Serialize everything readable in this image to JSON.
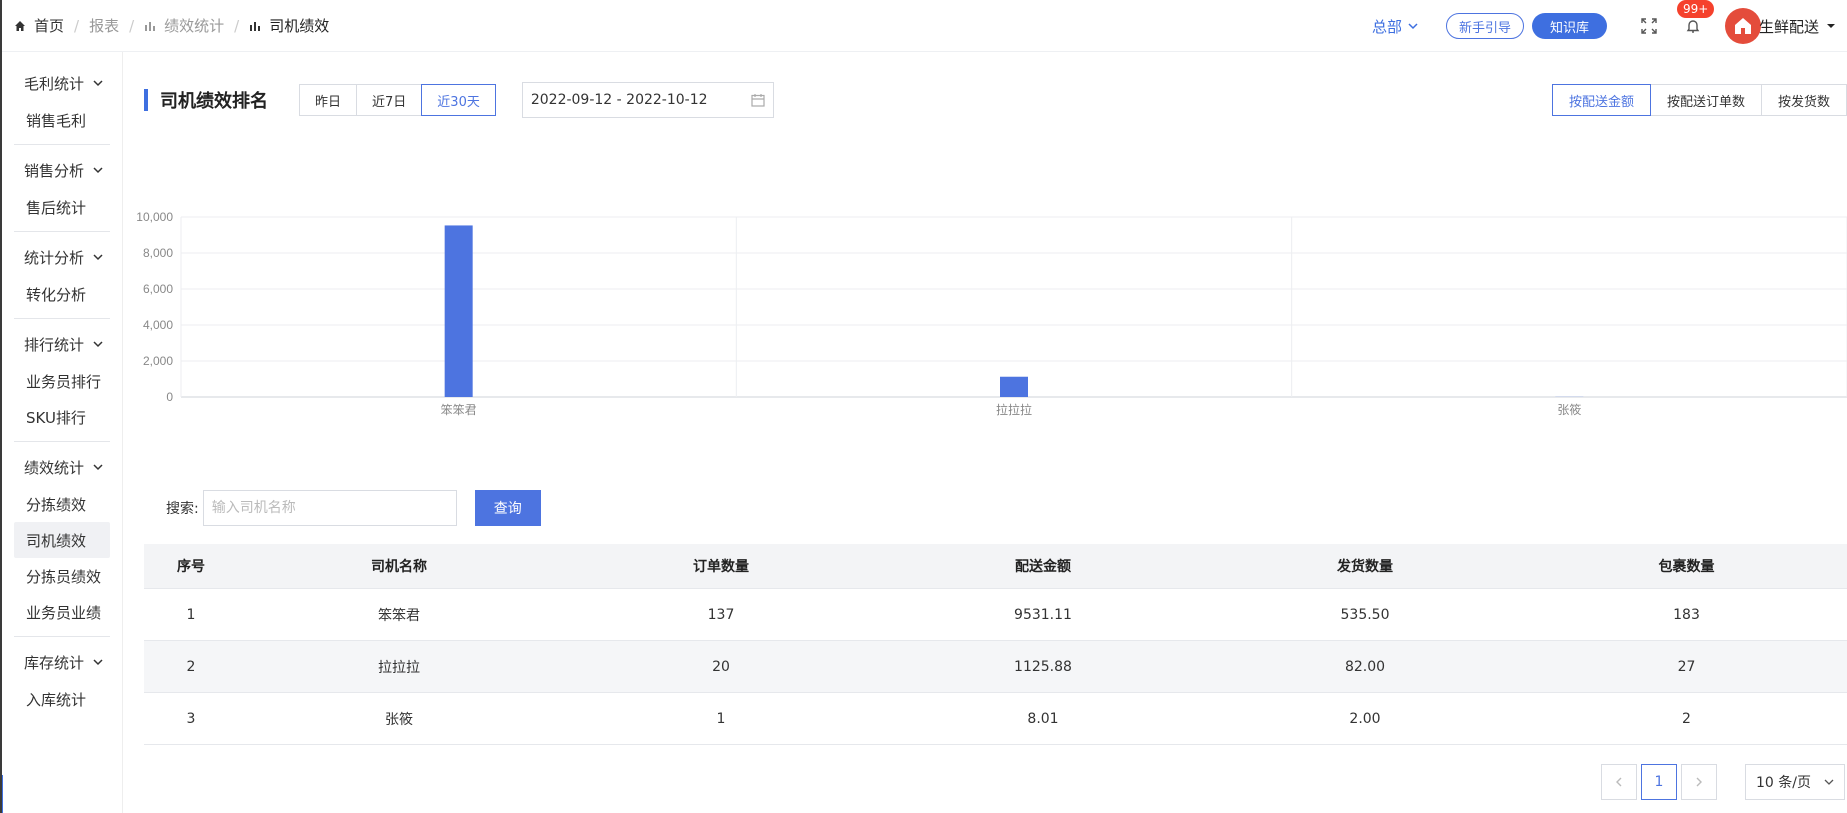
{
  "breadcrumb": {
    "home": "首页",
    "report": "报表",
    "stats": "绩效统计",
    "current": "司机绩效"
  },
  "header": {
    "org": "总部",
    "guide_btn": "新手引导",
    "kb_btn": "知识库",
    "badge": "99+",
    "user": "生鲜配送"
  },
  "sidebar": {
    "groups": [
      {
        "title": "毛利统计",
        "items": [
          "销售毛利"
        ]
      },
      {
        "title": "销售分析",
        "items": [
          "售后统计"
        ]
      },
      {
        "title": "统计分析",
        "items": [
          "转化分析"
        ]
      },
      {
        "title": "排行统计",
        "items": [
          "业务员排行",
          "SKU排行"
        ]
      },
      {
        "title": "绩效统计",
        "items": [
          "分拣绩效",
          "司机绩效",
          "分拣员绩效",
          "业务员业绩"
        ]
      },
      {
        "title": "库存统计",
        "items": [
          "入库统计"
        ]
      }
    ]
  },
  "main": {
    "title": "司机绩效排名",
    "ranges": [
      "昨日",
      "近7日",
      "近30天"
    ],
    "date_range": "2022-09-12 - 2022-10-12",
    "metrics": [
      "按配送金额",
      "按配送订单数",
      "按发货数"
    ]
  },
  "chart_data": {
    "type": "bar",
    "categories": [
      "笨笨君",
      "拉拉拉",
      "张筱"
    ],
    "values": [
      9531.11,
      1125.88,
      8.01
    ],
    "ylim": [
      0,
      10000
    ],
    "yticks": [
      "0",
      "2,000",
      "4,000",
      "6,000",
      "8,000",
      "10,000"
    ],
    "bar_color": "#4d74e0",
    "grid": true
  },
  "search": {
    "label": "搜索:",
    "placeholder": "输入司机名称",
    "button": "查询"
  },
  "table": {
    "columns": [
      "序号",
      "司机名称",
      "订单数量",
      "配送金额",
      "发货数量",
      "包裹数量"
    ],
    "rows": [
      [
        "1",
        "笨笨君",
        "137",
        "9531.11",
        "535.50",
        "183"
      ],
      [
        "2",
        "拉拉拉",
        "20",
        "1125.88",
        "82.00",
        "27"
      ],
      [
        "3",
        "张筱",
        "1",
        "8.01",
        "2.00",
        "2"
      ]
    ]
  },
  "pagination": {
    "page": "1",
    "page_size": "10 条/页"
  },
  "colors": {
    "accent": "#3e6fe0",
    "badge": "#f5412c"
  }
}
